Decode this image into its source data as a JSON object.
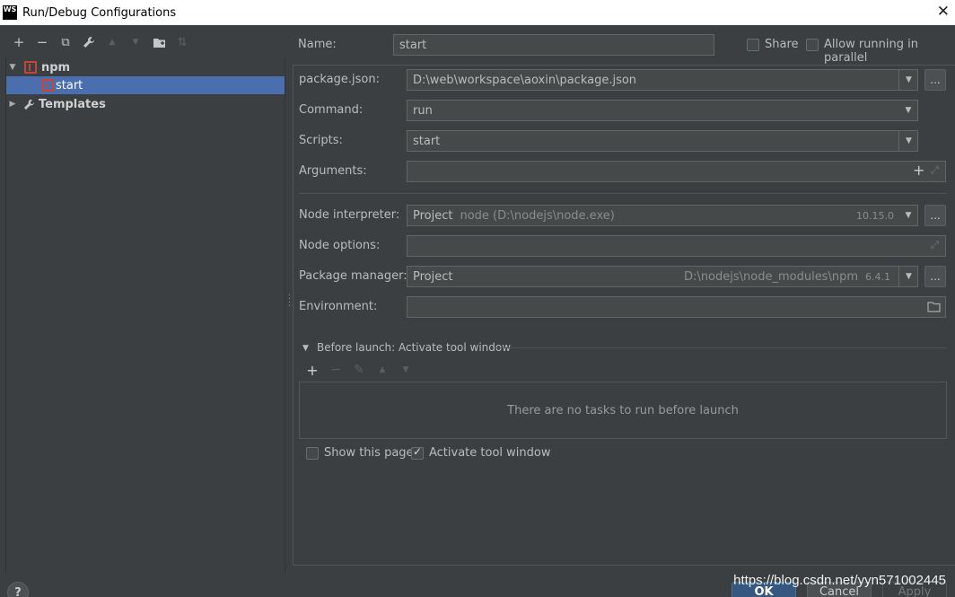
{
  "window": {
    "app_icon_text": "WS",
    "title": "Run/Debug Configurations",
    "close_glyph": "✕"
  },
  "left_toolbar": {
    "icons": [
      "add-icon",
      "remove-icon",
      "copy-icon",
      "wrench-icon",
      "move-up-icon",
      "move-down-icon",
      "folder-add-icon",
      "sort-icon"
    ],
    "add_glyph": "+",
    "remove_glyph": "−",
    "copy_glyph": "⧉",
    "wrench_glyph": "🔧",
    "up_glyph": "▲",
    "down_glyph": "▼",
    "folder_glyph": "▣",
    "sort_glyph": "⇅"
  },
  "tree": {
    "groups": [
      {
        "label": "npm",
        "expanded": true,
        "children": [
          {
            "label": "start",
            "selected": true
          }
        ]
      },
      {
        "label": "Templates",
        "expanded": false
      }
    ]
  },
  "name_row": {
    "label": "Name:",
    "value": "start",
    "share_label": "Share",
    "share_checked": false,
    "parallel_label": "Allow running in parallel",
    "parallel_checked": false
  },
  "form": {
    "package_json": {
      "label": "package.json:",
      "value": "D:\\web\\workspace\\aoxin\\package.json"
    },
    "command": {
      "label": "Command:",
      "value": "run"
    },
    "scripts": {
      "label": "Scripts:",
      "value": "start"
    },
    "arguments": {
      "label": "Arguments:",
      "value": ""
    },
    "node_interpreter": {
      "label": "Node interpreter:",
      "value": "Project",
      "path": "node (D:\\nodejs\\node.exe)",
      "version": "10.15.0"
    },
    "node_options": {
      "label": "Node options:",
      "value": ""
    },
    "package_manager": {
      "label": "Package manager:",
      "value": "Project",
      "path": "D:\\nodejs\\node_modules\\npm",
      "version": "6.4.1"
    },
    "environment": {
      "label": "Environment:",
      "value": ""
    },
    "ellipsis": "..."
  },
  "before_launch": {
    "title": "Before launch: Activate tool window",
    "add_glyph": "+",
    "remove_glyph": "−",
    "edit_glyph": "✎",
    "up_glyph": "▲",
    "down_glyph": "▼",
    "empty_text": "There are no tasks to run before launch",
    "show_page_label": "Show this page",
    "show_page_checked": false,
    "activate_label": "Activate tool window",
    "activate_checked": true
  },
  "footer": {
    "help_label": "?",
    "ok_label": "OK",
    "cancel_label": "Cancel",
    "apply_label": "Apply",
    "watermark": "https://blog.csdn.net/yyn571002445"
  },
  "colors": {
    "background": "#3c3f41",
    "selection": "#4b6eaf",
    "npm_red": "#c3463a",
    "ok_blue": "#365880"
  }
}
